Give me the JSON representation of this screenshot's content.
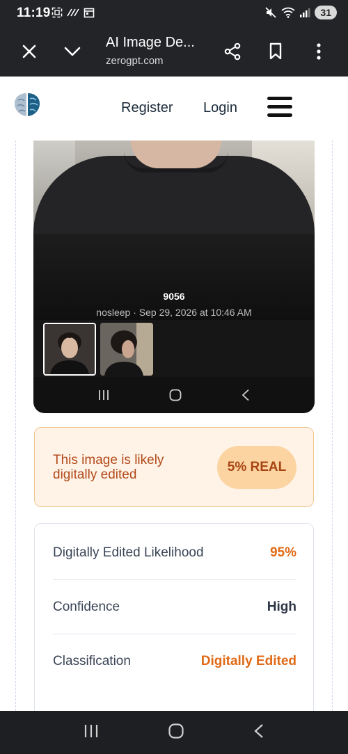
{
  "status_bar": {
    "time": "11:19",
    "battery": "31",
    "left_icons": [
      "screenshot-icon",
      "data-saver-icon",
      "calendar-icon"
    ],
    "right_icons": [
      "mute-icon",
      "wifi-icon",
      "signal-icon"
    ]
  },
  "browser": {
    "title": "AI Image De...",
    "domain": "zerogpt.com"
  },
  "site": {
    "nav_register": "Register",
    "nav_login": "Login"
  },
  "preview": {
    "title": "9056",
    "subtitle": "nosleep · Sep 29, 2026 at 10:46 AM"
  },
  "result": {
    "message": "This image is likely digitally edited",
    "badge": "5% REAL",
    "colors": {
      "text": "#b3491a",
      "background": "#fef3e6",
      "pill": "#fbd4a1"
    }
  },
  "details": {
    "rows": [
      {
        "label": "Digitally Edited Likelihood",
        "value": "95%"
      },
      {
        "label": "Confidence",
        "value": "High"
      },
      {
        "label": "Classification",
        "value": "Digitally Edited"
      }
    ],
    "accent": "#e06a16"
  }
}
